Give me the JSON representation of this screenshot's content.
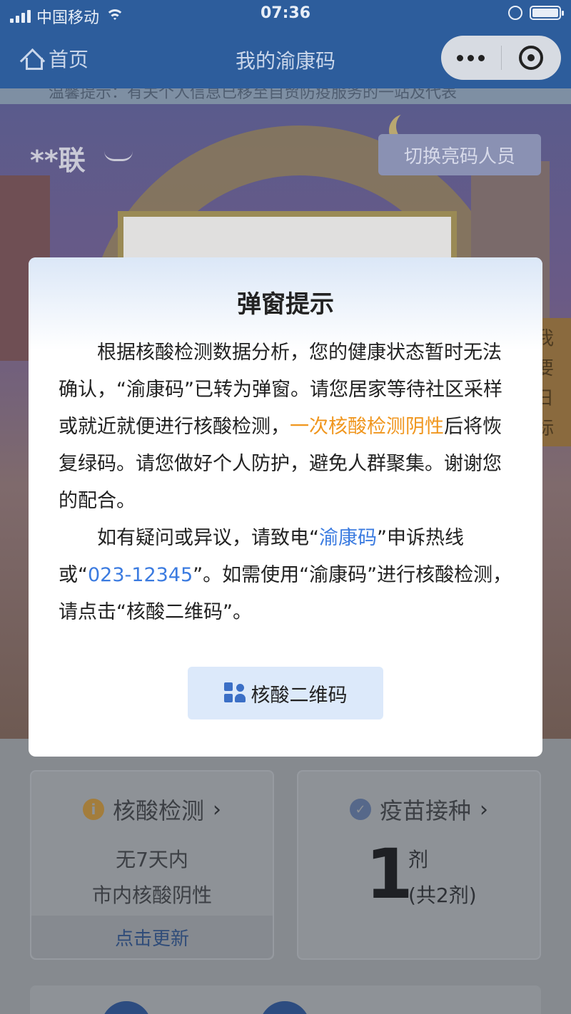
{
  "status_bar": {
    "carrier": "中国移动",
    "time": "07:36"
  },
  "nav": {
    "home_label": "首页",
    "title": "我的渝康码"
  },
  "tip_strip": "温馨提示：有关个人信息已移至自贸防疫服务的一站及代表",
  "profile": {
    "name": "**联",
    "switch_button": "切换亮码人员"
  },
  "banner_side_text": [
    "我",
    "要",
    "日",
    "标"
  ],
  "modal": {
    "title": "弹窗提示",
    "para1_a": "根据核酸检测数据分析，您的健康状态暂时无法确认，“渝康码”已转为弹窗。请您居家等待社区采样或就近就便进行核酸检测，",
    "para1_highlight": "一次核酸检测阴性",
    "para1_b": "后将恢复绿码。请您做好个人防护，避免人群聚集。谢谢您的配合。",
    "para2_a": "如有疑问或异议，请致电“",
    "para2_link1": "渝康码",
    "para2_b": "”申诉热线或“",
    "para2_link2": "023-12345",
    "para2_c": "”。如需使用“渝康码”进行核酸检测，请点击“核酸二维码”。",
    "button_label": "核酸二维码"
  },
  "cards": {
    "nucleic": {
      "title": "核酸检测",
      "line1": "无7天内",
      "line2": "市内核酸阴性",
      "footer": "点击更新"
    },
    "vaccine": {
      "title": "疫苗接种",
      "dose": "1",
      "unit": "剂",
      "total": "(共2剂)"
    }
  },
  "colors": {
    "nav_bg": "#2d5d9c",
    "accent_orange": "#f0961e",
    "accent_blue": "#3b7be0",
    "qr_button_bg": "#dce9fa"
  }
}
